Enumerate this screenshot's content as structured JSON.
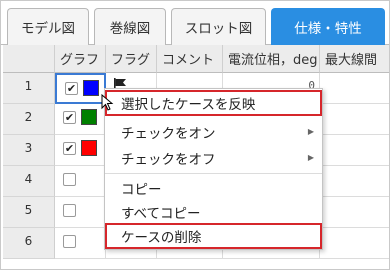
{
  "tabs": [
    {
      "label": "モデル図",
      "active": false
    },
    {
      "label": "巻線図",
      "active": false
    },
    {
      "label": "スロット図",
      "active": false
    },
    {
      "label": "仕様・特性",
      "active": true
    }
  ],
  "columns": [
    "グラフ",
    "フラグ",
    "コメント",
    "電流位相，deg",
    "最大線間"
  ],
  "rows": [
    {
      "num": "1",
      "checked": true,
      "color": "#0000ff",
      "flag": true,
      "phase": "0"
    },
    {
      "num": "2",
      "checked": true,
      "color": "#008000",
      "flag": false,
      "phase": ""
    },
    {
      "num": "3",
      "checked": true,
      "color": "#ff0000",
      "flag": false,
      "phase": ""
    },
    {
      "num": "4",
      "checked": false,
      "color": "",
      "flag": false,
      "phase": ""
    },
    {
      "num": "5",
      "checked": false,
      "color": "",
      "flag": false,
      "phase": ""
    },
    {
      "num": "6",
      "checked": false,
      "color": "",
      "flag": false,
      "phase": ""
    }
  ],
  "menu": {
    "items": [
      {
        "label": "選択したケースを反映",
        "submenu": false,
        "highlighted": true
      },
      {
        "label": "チェックをオン",
        "submenu": true,
        "highlighted": false
      },
      {
        "label": "チェックをオフ",
        "submenu": true,
        "highlighted": false
      },
      {
        "label": "コピー",
        "submenu": false,
        "highlighted": false
      },
      {
        "label": "すべてコピー",
        "submenu": false,
        "highlighted": false
      },
      {
        "label": "ケースの削除",
        "submenu": false,
        "highlighted": true
      }
    ]
  },
  "colors": {
    "accent": "#2a8ee2",
    "highlight_box": "#d6262b"
  }
}
